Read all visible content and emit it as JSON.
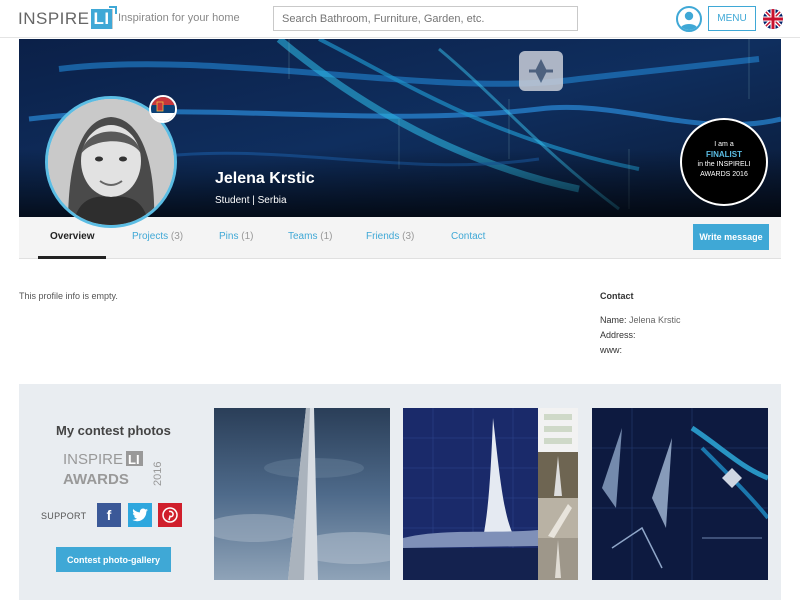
{
  "header": {
    "logo_text": "INSPIRE",
    "logo_box": "LI",
    "tagline": "Inspiration for your home",
    "search_placeholder": "Search Bathroom, Furniture, Garden, etc.",
    "menu_label": "MENU"
  },
  "profile": {
    "name": "Jelena Krstic",
    "subtitle": "Student | Serbia",
    "badge": {
      "line1": "I am a",
      "line2": "FINALIST",
      "line3": "in the INSPIRELI",
      "line4": "AWARDS 2016"
    }
  },
  "tabs": [
    {
      "label": "Overview",
      "count": ""
    },
    {
      "label": "Projects",
      "count": "(3)"
    },
    {
      "label": "Pins",
      "count": "(1)"
    },
    {
      "label": "Teams",
      "count": "(1)"
    },
    {
      "label": "Friends",
      "count": "(3)"
    },
    {
      "label": "Contact",
      "count": ""
    }
  ],
  "write_message_label": "Write message",
  "info": {
    "empty_text": "This profile info is empty.",
    "contact_title": "Contact",
    "name_label": "Name:",
    "name_value": "Jelena Krstic",
    "address_label": "Address:",
    "www_label": "www:"
  },
  "contest": {
    "title": "My contest photos",
    "awards_top": "INSPIRE",
    "awards_box": "LI",
    "awards_bottom": "AWARDS",
    "awards_year": "2016",
    "support_label": "SUPPORT",
    "gallery_button": "Contest photo-gallery"
  },
  "colors": {
    "accent": "#3fa8d6",
    "facebook": "#3b5998",
    "twitter": "#2ea7de",
    "pinterest": "#d01f2c"
  }
}
